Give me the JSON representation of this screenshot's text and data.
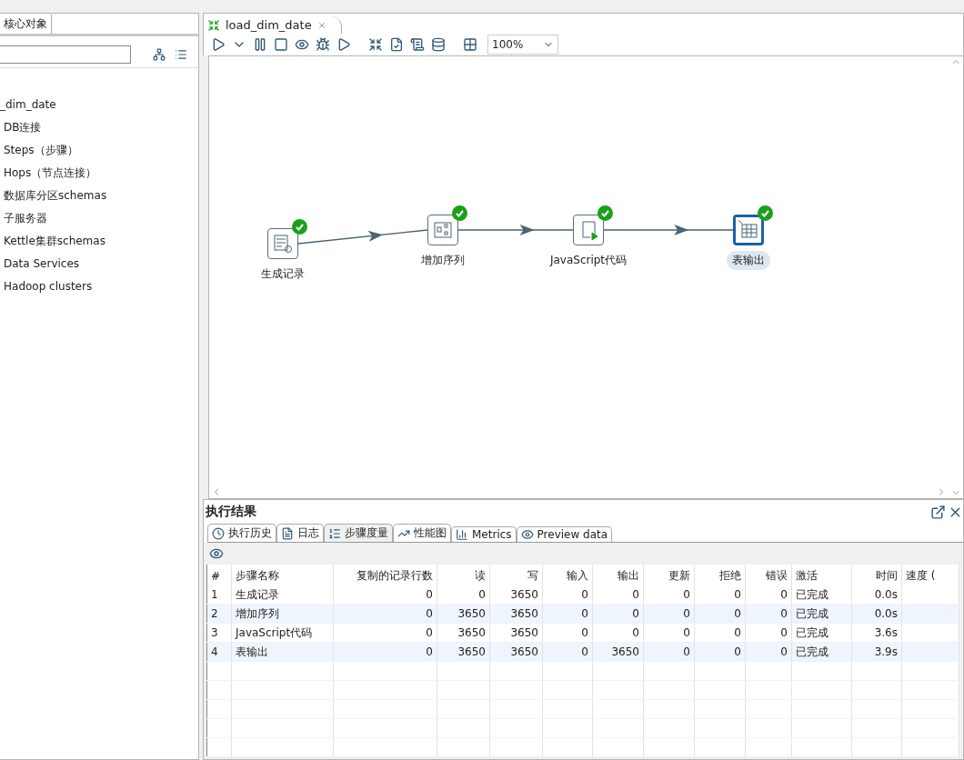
{
  "left_panel": {
    "tabs": [
      {
        "label": "核心对象",
        "selected": true
      }
    ],
    "tree": [
      {
        "label": "_dim_date"
      },
      {
        "label": "DB连接"
      },
      {
        "label": "Steps（步骤）"
      },
      {
        "label": "Hops（节点连接）"
      },
      {
        "label": "数据库分区schemas"
      },
      {
        "label": "子服务器"
      },
      {
        "label": "Kettle集群schemas"
      },
      {
        "label": "Data Services"
      },
      {
        "label": "Hadoop clusters"
      }
    ]
  },
  "editor": {
    "tabs": [
      {
        "label": "load_dim_date",
        "selected": true
      }
    ],
    "zoom": "100%",
    "steps": [
      {
        "label": "生成记录",
        "kind": "generate",
        "finished": true,
        "selected": false
      },
      {
        "label": "增加序列",
        "kind": "sequence",
        "finished": true,
        "selected": false
      },
      {
        "label": "JavaScript代码",
        "kind": "script",
        "finished": true,
        "selected": false
      },
      {
        "label": "表输出",
        "kind": "table_output",
        "finished": true,
        "selected": true
      }
    ],
    "hops": [
      {
        "kind": "arrow"
      },
      {
        "kind": "arrow"
      },
      {
        "kind": "arrow"
      }
    ]
  },
  "results": {
    "title": "执行结果",
    "tabs": [
      {
        "label": "执行历史",
        "kind": "history",
        "selected": false
      },
      {
        "label": "日志",
        "kind": "log",
        "selected": false
      },
      {
        "label": "步骤度量",
        "kind": "metrics_list",
        "selected": true
      },
      {
        "label": "性能图",
        "kind": "chart",
        "selected": false
      },
      {
        "label": "Metrics",
        "kind": "gantt",
        "selected": false
      },
      {
        "label": "Preview data",
        "kind": "preview",
        "selected": false
      }
    ],
    "columns": [
      "#",
      "步骤名称",
      "复制的记录行数",
      "读",
      "写",
      "输入",
      "输出",
      "更新",
      "拒绝",
      "错误",
      "激活",
      "时间",
      "速度 ("
    ],
    "rows": [
      [
        "1",
        "生成记录",
        "0",
        "0",
        "3650",
        "0",
        "0",
        "0",
        "0",
        "0",
        "已完成",
        "0.0s",
        ""
      ],
      [
        "2",
        "增加序列",
        "0",
        "3650",
        "3650",
        "0",
        "0",
        "0",
        "0",
        "0",
        "已完成",
        "0.0s",
        ""
      ],
      [
        "3",
        "JavaScript代码",
        "0",
        "3650",
        "3650",
        "0",
        "0",
        "0",
        "0",
        "0",
        "已完成",
        "3.6s",
        ""
      ],
      [
        "4",
        "表输出",
        "0",
        "3650",
        "3650",
        "0",
        "3650",
        "0",
        "0",
        "0",
        "已完成",
        "3.9s",
        ""
      ]
    ]
  }
}
